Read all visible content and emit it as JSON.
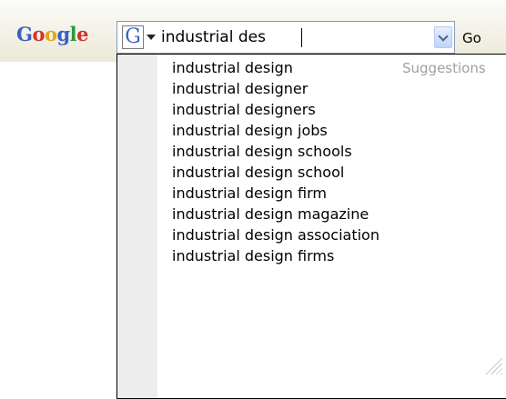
{
  "toolbar": {
    "logo_letters": [
      {
        "char": "G",
        "color": "#3b5fc4"
      },
      {
        "char": "o",
        "color": "#d0342c"
      },
      {
        "char": "o",
        "color": "#e8a613"
      },
      {
        "char": "g",
        "color": "#3b5fc4"
      },
      {
        "char": "l",
        "color": "#2a9a3b"
      },
      {
        "char": "e",
        "color": "#d0342c"
      }
    ],
    "engine_icon_letter": "G",
    "search_value": "industrial des",
    "go_label": "Go"
  },
  "suggestions": {
    "header": "Suggestions",
    "items": [
      "industrial design",
      "industrial designer",
      "industrial designers",
      "industrial design jobs",
      "industrial design schools",
      "industrial design school",
      "industrial design firm",
      "industrial design magazine",
      "industrial design association",
      "industrial design firms"
    ]
  }
}
